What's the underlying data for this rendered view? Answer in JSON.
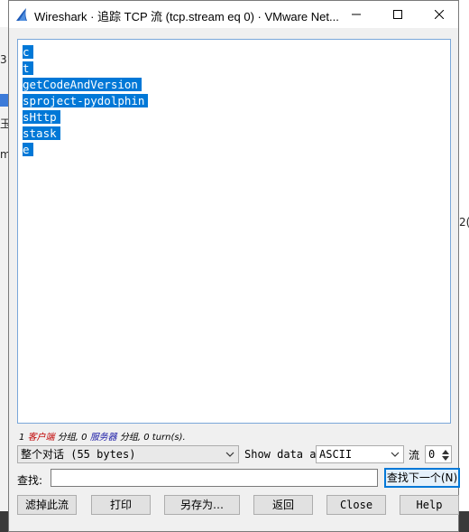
{
  "window": {
    "title": "Wireshark · 追踪 TCP 流 (tcp.stream eq 0) · VMware Net..."
  },
  "stream_lines": [
    "c",
    "t",
    "getCodeAndVersion",
    "sproject-pydolphin",
    "sHttp",
    "stask",
    "e"
  ],
  "status": {
    "client_count": "1",
    "client_label": "客户端",
    "client_suffix": "分组,",
    "server_count": "0",
    "server_label": "服务器",
    "server_suffix": "分组,",
    "turns": "0 turn(s)."
  },
  "conversation_select": "整个对话 (55 bytes)",
  "show_data_label": "Show data as",
  "format_select": "ASCII",
  "stream_label": "流",
  "stream_number": "0",
  "find_label": "查找:",
  "find_value": "",
  "buttons": {
    "find_next": "查找下一个(N)",
    "filter_out": "滤掉此流",
    "print": "打印",
    "save_as": "另存为…",
    "back": "返回",
    "close": "Close",
    "help": "Help"
  },
  "background_fragments": [
    "3",
    "玉",
    "m",
    "2("
  ]
}
